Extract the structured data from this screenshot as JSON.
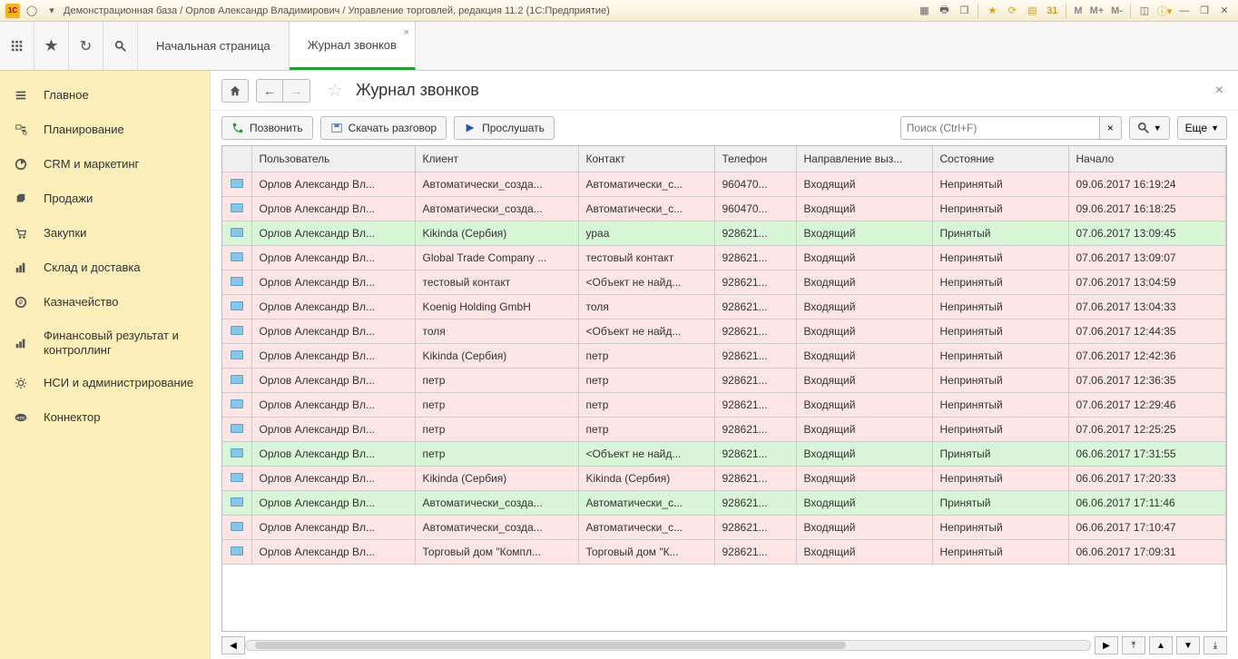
{
  "titlebar": {
    "title": "Демонстрационная база / Орлов Александр Владимирович / Управление торговлей, редакция 11.2  (1С:Предприятие)",
    "m_buttons": [
      "M",
      "M+",
      "M-"
    ]
  },
  "toolbar": {
    "tab_home": "Начальная страница",
    "tab_calllog": "Журнал звонков"
  },
  "sidebar": {
    "items": [
      {
        "label": "Главное",
        "icon": "menu"
      },
      {
        "label": "Планирование",
        "icon": "plan"
      },
      {
        "label": "CRM и маркетинг",
        "icon": "crm"
      },
      {
        "label": "Продажи",
        "icon": "sales"
      },
      {
        "label": "Закупки",
        "icon": "cart"
      },
      {
        "label": "Склад и доставка",
        "icon": "warehouse"
      },
      {
        "label": "Казначейство",
        "icon": "money"
      },
      {
        "label": "Финансовый результат и контроллинг",
        "icon": "chart"
      },
      {
        "label": "НСИ и администрирование",
        "icon": "gear"
      },
      {
        "label": "Коннектор",
        "icon": "connector"
      }
    ]
  },
  "page": {
    "title": "Журнал звонков",
    "call_btn": "Позвонить",
    "download_btn": "Скачать разговор",
    "listen_btn": "Прослушать",
    "search_placeholder": "Поиск (Ctrl+F)",
    "more_btn": "Еще"
  },
  "table": {
    "cols": [
      "Пользователь",
      "Клиент",
      "Контакт",
      "Телефон",
      "Направление выз...",
      "Состояние",
      "Начало"
    ],
    "rows": [
      {
        "user": "Орлов Александр Вл...",
        "client": "Автоматически_созда...",
        "contact": "Автоматически_с...",
        "phone": "960470...",
        "dir": "Входящий",
        "state": "Непринятый",
        "start": "09.06.2017 16:19:24",
        "color": "red"
      },
      {
        "user": "Орлов Александр Вл...",
        "client": "Автоматически_созда...",
        "contact": "Автоматически_с...",
        "phone": "960470...",
        "dir": "Входящий",
        "state": "Непринятый",
        "start": "09.06.2017 16:18:25",
        "color": "red"
      },
      {
        "user": "Орлов Александр Вл...",
        "client": "Kikinda (Сербия)",
        "contact": "ураа",
        "phone": "928621...",
        "dir": "Входящий",
        "state": "Принятый",
        "start": "07.06.2017 13:09:45",
        "color": "green"
      },
      {
        "user": "Орлов Александр Вл...",
        "client": "Global Trade Company ...",
        "contact": "тестовый контакт",
        "phone": "928621...",
        "dir": "Входящий",
        "state": "Непринятый",
        "start": "07.06.2017 13:09:07",
        "color": "red"
      },
      {
        "user": "Орлов Александр Вл...",
        "client": "тестовый контакт",
        "contact": "<Объект не найд...",
        "phone": "928621...",
        "dir": "Входящий",
        "state": "Непринятый",
        "start": "07.06.2017 13:04:59",
        "color": "red"
      },
      {
        "user": "Орлов Александр Вл...",
        "client": "Koenig Holding GmbH",
        "contact": "толя",
        "phone": "928621...",
        "dir": "Входящий",
        "state": "Непринятый",
        "start": "07.06.2017 13:04:33",
        "color": "red"
      },
      {
        "user": "Орлов Александр Вл...",
        "client": "толя",
        "contact": "<Объект не найд...",
        "phone": "928621...",
        "dir": "Входящий",
        "state": "Непринятый",
        "start": "07.06.2017 12:44:35",
        "color": "red"
      },
      {
        "user": "Орлов Александр Вл...",
        "client": "Kikinda (Сербия)",
        "contact": "петр",
        "phone": "928621...",
        "dir": "Входящий",
        "state": "Непринятый",
        "start": "07.06.2017 12:42:36",
        "color": "red"
      },
      {
        "user": "Орлов Александр Вл...",
        "client": "петр",
        "contact": "петр",
        "phone": "928621...",
        "dir": "Входящий",
        "state": "Непринятый",
        "start": "07.06.2017 12:36:35",
        "color": "red"
      },
      {
        "user": "Орлов Александр Вл...",
        "client": "петр",
        "contact": "петр",
        "phone": "928621...",
        "dir": "Входящий",
        "state": "Непринятый",
        "start": "07.06.2017 12:29:46",
        "color": "red"
      },
      {
        "user": "Орлов Александр Вл...",
        "client": "петр",
        "contact": "петр",
        "phone": "928621...",
        "dir": "Входящий",
        "state": "Непринятый",
        "start": "07.06.2017 12:25:25",
        "color": "red"
      },
      {
        "user": "Орлов Александр Вл...",
        "client": "петр",
        "contact": "<Объект не найд...",
        "phone": "928621...",
        "dir": "Входящий",
        "state": "Принятый",
        "start": "06.06.2017 17:31:55",
        "color": "green"
      },
      {
        "user": "Орлов Александр Вл...",
        "client": "Kikinda (Сербия)",
        "contact": "Kikinda (Сербия)",
        "phone": "928621...",
        "dir": "Входящий",
        "state": "Непринятый",
        "start": "06.06.2017 17:20:33",
        "color": "red"
      },
      {
        "user": "Орлов Александр Вл...",
        "client": "Автоматически_созда...",
        "contact": "Автоматически_с...",
        "phone": "928621...",
        "dir": "Входящий",
        "state": "Принятый",
        "start": "06.06.2017 17:11:46",
        "color": "green"
      },
      {
        "user": "Орлов Александр Вл...",
        "client": "Автоматически_созда...",
        "contact": "Автоматически_с...",
        "phone": "928621...",
        "dir": "Входящий",
        "state": "Непринятый",
        "start": "06.06.2017 17:10:47",
        "color": "red"
      },
      {
        "user": "Орлов Александр Вл...",
        "client": "Торговый дом \"Компл...",
        "contact": "Торговый дом \"К...",
        "phone": "928621...",
        "dir": "Входящий",
        "state": "Непринятый",
        "start": "06.06.2017 17:09:31",
        "color": "red"
      }
    ]
  }
}
